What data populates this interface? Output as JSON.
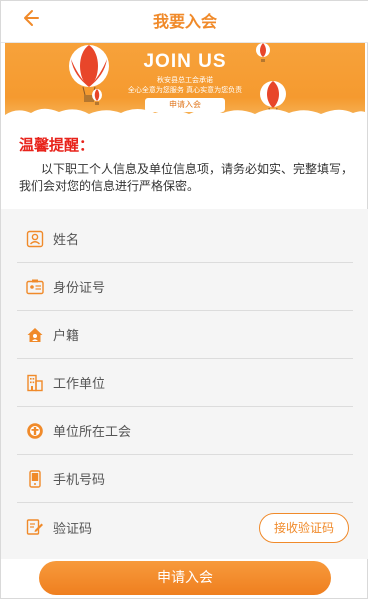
{
  "header": {
    "back_icon": "arrow-left-icon",
    "title": "我要入会"
  },
  "banner": {
    "title": "JOIN US",
    "org_line": "秋安县总工会承诺",
    "slogan": "全心全意为您服务   真心实意为您负责",
    "button_label": "申请入会"
  },
  "tip": {
    "title": "温馨提醒：",
    "body": "以下职工个人信息及单位信息项，请务必如实、完整填写，我们会对您的信息进行严格保密。"
  },
  "form": {
    "fields": [
      {
        "label": "姓名",
        "icon": "person-card-icon"
      },
      {
        "label": "身份证号",
        "icon": "id-card-icon"
      },
      {
        "label": "户籍",
        "icon": "home-icon"
      },
      {
        "label": "工作单位",
        "icon": "building-icon"
      },
      {
        "label": "单位所在工会",
        "icon": "union-badge-icon"
      },
      {
        "label": "手机号码",
        "icon": "phone-icon"
      },
      {
        "label": "验证码",
        "icon": "verify-edit-icon"
      }
    ],
    "sms_button": "接收验证码"
  },
  "submit_label": "申请入会",
  "colors": {
    "accent": "#f08a2a",
    "tip_red": "#e8231b",
    "form_bg": "#f5f5f5"
  }
}
